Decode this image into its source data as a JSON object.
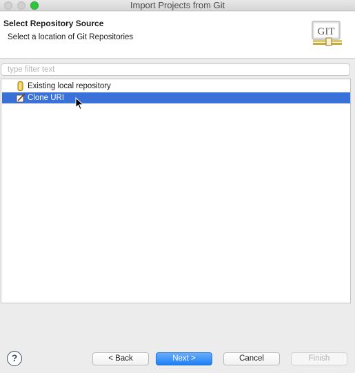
{
  "window": {
    "title": "Import Projects from Git"
  },
  "header": {
    "title": "Select Repository Source",
    "description": "Select a location of Git Repositories",
    "logo_text": "GIT"
  },
  "filter": {
    "placeholder": "type filter text",
    "value": ""
  },
  "tree": {
    "items": [
      {
        "label": "Existing local repository",
        "icon": "repository-icon",
        "selected": false
      },
      {
        "label": "Clone URI",
        "icon": "clone-uri-icon",
        "selected": true
      }
    ]
  },
  "buttons": {
    "help": "?",
    "back": "< Back",
    "next": "Next >",
    "cancel": "Cancel",
    "finish": "Finish"
  },
  "colors": {
    "selection": "#3a71d8",
    "default_button": "#1d80f5"
  }
}
